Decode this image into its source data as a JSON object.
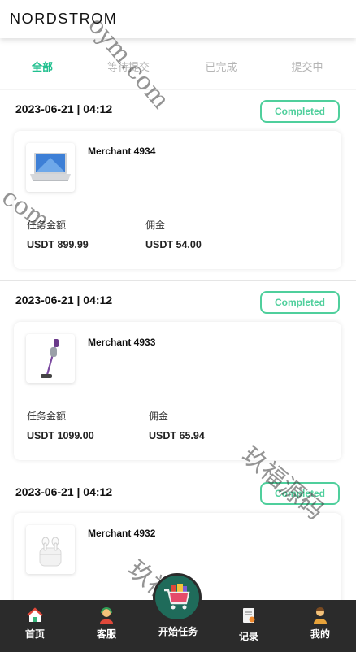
{
  "header": {
    "logo": "NORDSTROM"
  },
  "tabs": [
    {
      "label": "全部",
      "active": true
    },
    {
      "label": "等待提交",
      "active": false
    },
    {
      "label": "已完成",
      "active": false
    },
    {
      "label": "提交中",
      "active": false
    }
  ],
  "orders": [
    {
      "date": "2023-06-21 | 04:12",
      "status": "Completed",
      "merchant": "Merchant 4934",
      "product_icon": "laptop-image",
      "amount_label": "任务金额",
      "amount": "USDT 899.99",
      "commission_label": "佣金",
      "commission": "USDT 54.00"
    },
    {
      "date": "2023-06-21 | 04:12",
      "status": "Completed",
      "merchant": "Merchant 4933",
      "product_icon": "vacuum-image",
      "amount_label": "任务金额",
      "amount": "USDT 1099.00",
      "commission_label": "佣金",
      "commission": "USDT 65.94"
    },
    {
      "date": "2023-06-21 | 04:12",
      "status": "Completed",
      "merchant": "Merchant 4932",
      "product_icon": "earbuds-image"
    }
  ],
  "watermarks": [
    "oym.com",
    "com",
    "玖福源码",
    "玖福源码"
  ],
  "bottom_nav": {
    "home": "首页",
    "service": "客服",
    "start": "开始任务",
    "records": "记录",
    "mine": "我的"
  },
  "colors": {
    "accent": "#21c08f",
    "badge": "#4fcf9c",
    "nav_bg": "#2b2b2b",
    "center_btn": "#1f6b5a"
  }
}
